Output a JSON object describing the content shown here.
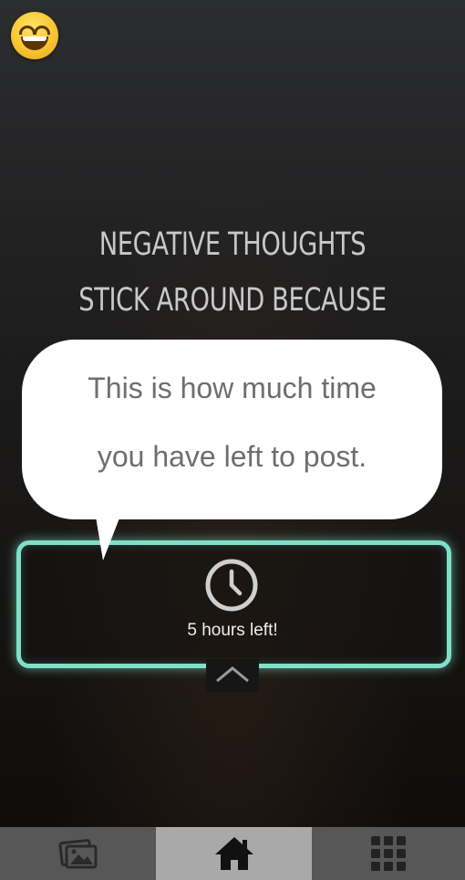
{
  "headline": {
    "line1": "NEGATIVE THOUGHTS",
    "line2": "STICK AROUND BECAUSE"
  },
  "tooltip": {
    "line1": "This is how much time",
    "line2": "you have left to post."
  },
  "timer": {
    "label": "5 hours left!",
    "icon": "clock-icon",
    "highlight_color": "#7fe0c8"
  },
  "status_emoji": "grinning-face-icon",
  "tabbar": {
    "items": [
      {
        "name": "gallery",
        "icon": "photos-icon",
        "active": false
      },
      {
        "name": "home",
        "icon": "home-icon",
        "active": true
      },
      {
        "name": "apps",
        "icon": "grid-icon",
        "active": false
      }
    ]
  }
}
